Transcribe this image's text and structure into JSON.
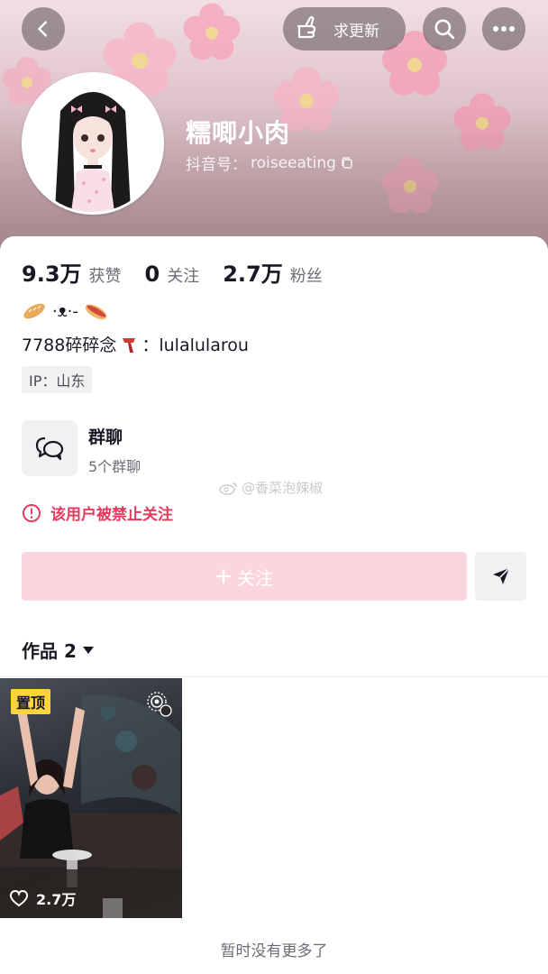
{
  "header": {
    "request_update_label": "求更新"
  },
  "profile": {
    "nickname": "糯唧小肉",
    "douyin_id_label": "抖音号：",
    "douyin_id": "roiseeating"
  },
  "stats": [
    {
      "value": "9.3万",
      "label": "获赞"
    },
    {
      "value": "0",
      "label": "关注"
    },
    {
      "value": "2.7万",
      "label": "粉丝"
    }
  ],
  "bio": {
    "line1_middle": "·ᴥ·‑",
    "line2_prefix": "7788碎碎念",
    "line2_suffix": "：lulalularou",
    "ip": "IP：山东"
  },
  "group_chat": {
    "title": "群聊",
    "subtitle": "5个群聊"
  },
  "watermark": "@香菜泡辣椒",
  "ban_notice": "该用户被禁止关注",
  "follow_label": "关注",
  "works": {
    "label": "作品 2"
  },
  "videos": [
    {
      "badge": "置顶",
      "likes": "2.7万"
    }
  ],
  "footer": "暂时没有更多了",
  "colors": {
    "accent_red": "#e43a5e",
    "follow_disabled": "#fcd6de",
    "pin_badge": "#fbd43a"
  }
}
